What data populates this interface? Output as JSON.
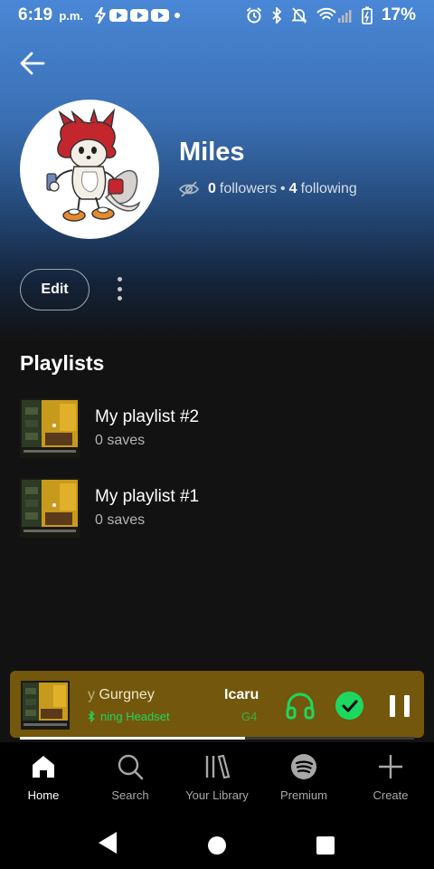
{
  "status_bar": {
    "time": "6:19",
    "ampm": "p.m.",
    "battery": "17%"
  },
  "profile": {
    "name": "Miles",
    "followers_count": "0",
    "followers_label": "followers",
    "separator": "•",
    "following_count": "4",
    "following_label": "following",
    "edit_label": "Edit"
  },
  "playlists": {
    "title": "Playlists",
    "items": [
      {
        "title": "My playlist #2",
        "subtitle": "0 saves"
      },
      {
        "title": "My playlist #1",
        "subtitle": "0 saves"
      }
    ]
  },
  "now_playing": {
    "artist_fade": "y",
    "artist": "Gurgney",
    "song": "Icaru",
    "device": "ning Headset",
    "device2": "G4",
    "progress": 0.57,
    "colors": {
      "background": "#73570c",
      "accent": "#1ed760"
    }
  },
  "bottom_nav": {
    "items": [
      {
        "label": "Home",
        "icon": "home-icon",
        "active": true
      },
      {
        "label": "Search",
        "icon": "search-icon",
        "active": false
      },
      {
        "label": "Your Library",
        "icon": "library-icon",
        "active": false
      },
      {
        "label": "Premium",
        "icon": "spotify-icon",
        "active": false
      },
      {
        "label": "Create",
        "icon": "plus-icon",
        "active": false
      }
    ]
  }
}
